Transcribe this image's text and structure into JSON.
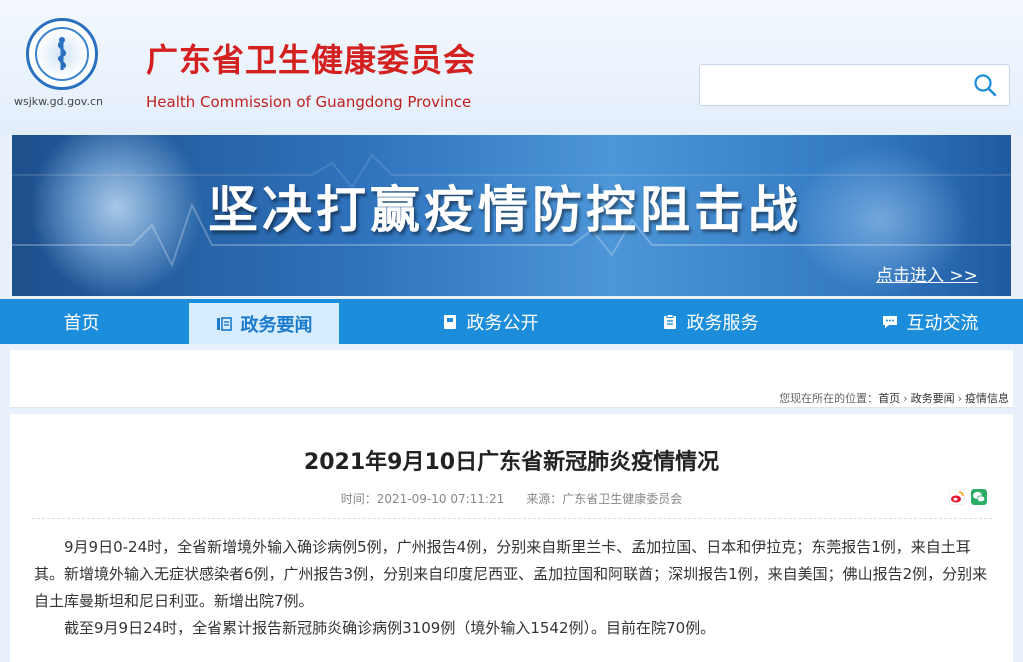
{
  "header": {
    "logo_alt": "广东省卫生健康委员会",
    "domain": "wsjkw.gd.gov.cn",
    "title": "广东省卫生健康委员会",
    "subtitle": "Health Commission of Guangdong Province",
    "search": {
      "placeholder": "",
      "value": ""
    }
  },
  "banner": {
    "slogan": "坚决打赢疫情防控阻击战",
    "link_label": "点击进入 >>"
  },
  "nav": {
    "items": [
      {
        "label": "首页",
        "icon": "none"
      },
      {
        "label": "政务要闻",
        "icon": "news-icon",
        "active": true
      },
      {
        "label": "政务公开",
        "icon": "book-icon"
      },
      {
        "label": "政务服务",
        "icon": "clipboard-icon"
      },
      {
        "label": "互动交流",
        "icon": "chat-icon"
      }
    ]
  },
  "breadcrumb": {
    "prefix": "您现在所在的位置：",
    "items": [
      "首页",
      "政务要闻",
      "疫情信息"
    ],
    "separator": "›"
  },
  "article": {
    "title": "2021年9月10日广东省新冠肺炎疫情情况",
    "time_label": "时间：2021-09-10 07:11:21",
    "source_label": "来源：广东省卫生健康委员会",
    "paragraphs": [
      "9月9日0-24时，全省新增境外输入确诊病例5例，广州报告4例，分别来自斯里兰卡、孟加拉国、日本和伊拉克；东莞报告1例，来自土耳其。新增境外输入无症状感染者6例，广州报告3例，分别来自印度尼西亚、孟加拉国和阿联酋；深圳报告1例，来自美国；佛山报告2例，分别来自土库曼斯坦和尼日利亚。新增出院7例。",
      "截至9月9日24时，全省累计报告新冠肺炎确诊病例3109例（境外输入1542例）。目前在院70例。"
    ],
    "share": [
      "weibo-icon",
      "wechat-icon"
    ]
  },
  "colors": {
    "brand_red": "#d2211f",
    "nav_blue": "#1c8ddb",
    "nav_active_bg": "#d6ecff",
    "banner_blue": "#2f73bd"
  }
}
